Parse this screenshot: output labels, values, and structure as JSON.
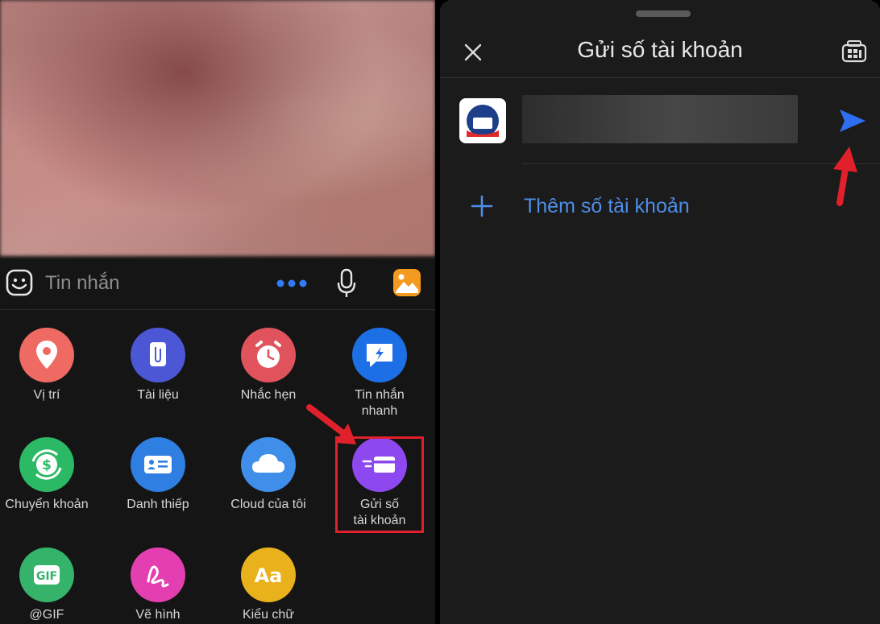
{
  "left_panel": {
    "composer": {
      "placeholder": "Tin nhắn",
      "icons": [
        "emoji-icon",
        "more-dots-icon",
        "microphone-icon",
        "gallery-icon"
      ]
    },
    "grid": [
      {
        "label": "Vị trí",
        "icon": "location-pin-icon",
        "color": "#ee6a63"
      },
      {
        "label": "Tài liệu",
        "icon": "document-icon",
        "color": "#4c57d6"
      },
      {
        "label": "Nhắc hẹn",
        "icon": "alarm-clock-icon",
        "color": "#e0535d"
      },
      {
        "label": "Tin nhắn\nnhanh",
        "icon": "quick-message-icon",
        "color": "#1d6fe6"
      },
      {
        "label": "Chuyển khoản",
        "icon": "money-transfer-icon",
        "color": "#2cb965"
      },
      {
        "label": "Danh thiếp",
        "icon": "business-card-icon",
        "color": "#2f7ee2"
      },
      {
        "label": "Cloud của tôi",
        "icon": "cloud-icon",
        "color": "#3e8eea"
      },
      {
        "label": "Gửi số\ntài khoản",
        "icon": "send-card-icon",
        "color": "#8d49ef"
      },
      {
        "label": "@GIF",
        "icon": "gif-icon",
        "color": "#35b36a"
      },
      {
        "label": "Vẽ hình",
        "icon": "draw-icon",
        "color": "#e43fb0"
      },
      {
        "label": "Kiểu chữ",
        "icon": "font-style-icon",
        "color": "#e9b21c"
      }
    ]
  },
  "right_panel": {
    "title": "Gửi số tài khoản",
    "icons": [
      "close-icon",
      "qr-card-icon",
      "send-icon"
    ],
    "add_label": "Thêm số tài khoản"
  },
  "colors": {
    "accent_blue": "#2d6ff0",
    "link_blue": "#4d8ee8",
    "highlight_red": "#e0202a"
  }
}
